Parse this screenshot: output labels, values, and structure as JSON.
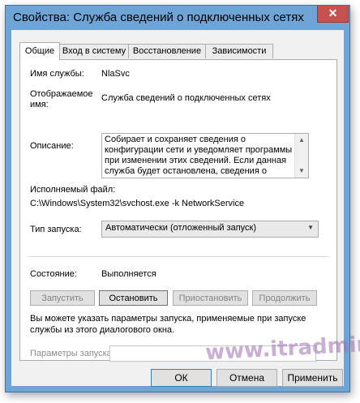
{
  "window": {
    "title": "Свойства: Служба сведений о подключенных сетях",
    "close_glyph": "✕"
  },
  "tabs": [
    {
      "label": "Общие",
      "active": true
    },
    {
      "label": "Вход в систему",
      "active": false
    },
    {
      "label": "Восстановление",
      "active": false
    },
    {
      "label": "Зависимости",
      "active": false
    }
  ],
  "general": {
    "service_name_label": "Имя службы:",
    "service_name_value": "NlaSvc",
    "display_name_label_1": "Отображаемое",
    "display_name_label_2": "имя:",
    "display_name_value": "Служба сведений о подключенных сетях",
    "description_label": "Описание:",
    "description_text": "Собирает и сохраняет сведения о конфигурации сети и уведомляет программы при изменении этих сведений. Если данная служба будет остановлена, сведения о конфигурации могут",
    "executable_label": "Исполняемый файл:",
    "executable_value": "C:\\Windows\\System32\\svchost.exe -k NetworkService",
    "startup_type_label": "Тип запуска:",
    "startup_type_value": "Автоматически (отложенный запуск)",
    "status_label": "Состояние:",
    "status_value": "Выполняется",
    "service_buttons": {
      "start": "Запустить",
      "stop": "Остановить",
      "pause": "Приостановить",
      "resume": "Продолжить"
    },
    "hint_line_1": "Вы можете указать параметры запуска, применяемые при запуске",
    "hint_line_2": "службы из этого диалогового окна.",
    "start_params_label": "Параметры запуска:",
    "start_params_value": ""
  },
  "dialog_buttons": {
    "ok": "ОК",
    "cancel": "Отмена",
    "apply": "Применить"
  },
  "watermark": "www.itradmin.ru",
  "icons": {
    "scroll_up": "▲",
    "scroll_down": "▼",
    "combo_arrow": "▼"
  }
}
